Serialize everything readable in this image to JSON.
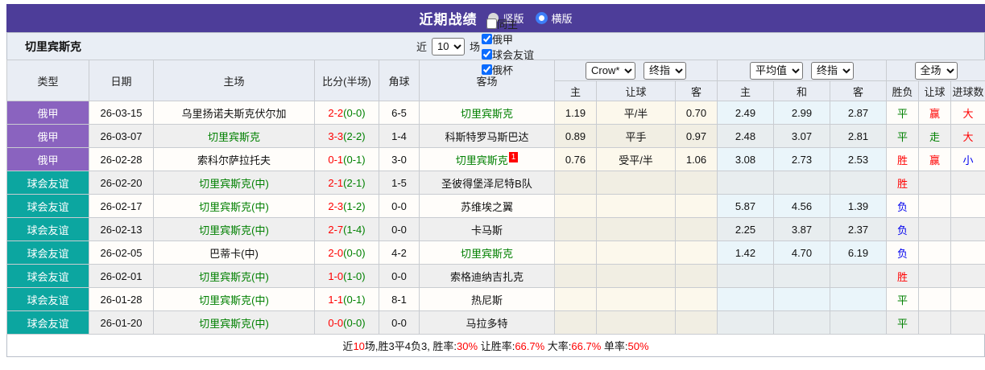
{
  "title_bar": {
    "title": "近期战绩",
    "radio_vertical": "竖版",
    "radio_horizontal": "横版",
    "selected": "横版"
  },
  "team_bar": {
    "team_name": "切里宾斯克",
    "near_label": "近",
    "matches_count": "10",
    "matches_label": "场",
    "filters": [
      {
        "label": "同主",
        "checked": false,
        "spaced": true
      },
      {
        "label": "俄甲",
        "checked": true,
        "spaced": false
      },
      {
        "label": "球会友谊",
        "checked": true,
        "spaced": false
      },
      {
        "label": "俄杯",
        "checked": true,
        "spaced": false
      }
    ]
  },
  "table": {
    "dropdowns": {
      "bookmaker": "Crow*",
      "bookmaker_stage": "终指",
      "average": "平均值",
      "average_stage": "终指",
      "scope": "全场"
    },
    "headers": {
      "type": "类型",
      "date": "日期",
      "home": "主场",
      "score": "比分(半场)",
      "corner": "角球",
      "away": "客场",
      "odds_home": "主",
      "odds_handicap": "让球",
      "odds_away": "客",
      "avg_home": "主",
      "avg_draw": "和",
      "avg_away": "客",
      "result": "胜负",
      "handicap_result": "让球",
      "goals_result": "进球数"
    },
    "rows": [
      {
        "type": "俄甲",
        "type_key": "league",
        "date": "26-03-15",
        "home": "乌里扬诺夫斯克伏尔加",
        "home_focus": false,
        "score_full": "2-2",
        "score_half": "(0-0)",
        "corner": "6-5",
        "away": "切里宾斯克",
        "away_focus": true,
        "away_badge": "",
        "crow": [
          "1.19",
          "平/半",
          "0.70"
        ],
        "avg": [
          "2.49",
          "2.99",
          "2.87"
        ],
        "result": {
          "text": "平",
          "color": "green"
        },
        "handicap": {
          "text": "赢",
          "color": "red"
        },
        "goals": {
          "text": "大",
          "color": "red"
        }
      },
      {
        "type": "俄甲",
        "type_key": "league",
        "date": "26-03-07",
        "home": "切里宾斯克",
        "home_focus": true,
        "score_full": "3-3",
        "score_half": "(2-2)",
        "corner": "1-4",
        "away": "科斯特罗马斯巴达",
        "away_focus": false,
        "away_badge": "",
        "crow": [
          "0.89",
          "平手",
          "0.97"
        ],
        "avg": [
          "2.48",
          "3.07",
          "2.81"
        ],
        "result": {
          "text": "平",
          "color": "green"
        },
        "handicap": {
          "text": "走",
          "color": "green"
        },
        "goals": {
          "text": "大",
          "color": "red"
        }
      },
      {
        "type": "俄甲",
        "type_key": "league",
        "date": "26-02-28",
        "home": "索科尔萨拉托夫",
        "home_focus": false,
        "score_full": "0-1",
        "score_half": "(0-1)",
        "corner": "3-0",
        "away": "切里宾斯克",
        "away_focus": true,
        "away_badge": "1",
        "crow": [
          "0.76",
          "受平/半",
          "1.06"
        ],
        "avg": [
          "3.08",
          "2.73",
          "2.53"
        ],
        "result": {
          "text": "胜",
          "color": "red"
        },
        "handicap": {
          "text": "赢",
          "color": "red"
        },
        "goals": {
          "text": "小",
          "color": "blue"
        }
      },
      {
        "type": "球会友谊",
        "type_key": "friendly",
        "date": "26-02-20",
        "home": "切里宾斯克(中)",
        "home_focus": true,
        "score_full": "2-1",
        "score_half": "(2-1)",
        "corner": "1-5",
        "away": "圣彼得堡泽尼特B队",
        "away_focus": false,
        "away_badge": "",
        "crow": [
          "",
          "",
          ""
        ],
        "avg": [
          "",
          "",
          ""
        ],
        "result": {
          "text": "胜",
          "color": "red"
        },
        "handicap": {
          "text": "",
          "color": ""
        },
        "goals": {
          "text": "",
          "color": ""
        }
      },
      {
        "type": "球会友谊",
        "type_key": "friendly",
        "date": "26-02-17",
        "home": "切里宾斯克(中)",
        "home_focus": true,
        "score_full": "2-3",
        "score_half": "(1-2)",
        "corner": "0-0",
        "away": "苏维埃之翼",
        "away_focus": false,
        "away_badge": "",
        "crow": [
          "",
          "",
          ""
        ],
        "avg": [
          "5.87",
          "4.56",
          "1.39"
        ],
        "result": {
          "text": "负",
          "color": "blue"
        },
        "handicap": {
          "text": "",
          "color": ""
        },
        "goals": {
          "text": "",
          "color": ""
        }
      },
      {
        "type": "球会友谊",
        "type_key": "friendly",
        "date": "26-02-13",
        "home": "切里宾斯克(中)",
        "home_focus": true,
        "score_full": "2-7",
        "score_half": "(1-4)",
        "corner": "0-0",
        "away": "卡马斯",
        "away_focus": false,
        "away_badge": "",
        "crow": [
          "",
          "",
          ""
        ],
        "avg": [
          "2.25",
          "3.87",
          "2.37"
        ],
        "result": {
          "text": "负",
          "color": "blue"
        },
        "handicap": {
          "text": "",
          "color": ""
        },
        "goals": {
          "text": "",
          "color": ""
        }
      },
      {
        "type": "球会友谊",
        "type_key": "friendly",
        "date": "26-02-05",
        "home": "巴蒂卡(中)",
        "home_focus": false,
        "score_full": "2-0",
        "score_half": "(0-0)",
        "corner": "4-2",
        "away": "切里宾斯克",
        "away_focus": true,
        "away_badge": "",
        "crow": [
          "",
          "",
          ""
        ],
        "avg": [
          "1.42",
          "4.70",
          "6.19"
        ],
        "result": {
          "text": "负",
          "color": "blue"
        },
        "handicap": {
          "text": "",
          "color": ""
        },
        "goals": {
          "text": "",
          "color": ""
        }
      },
      {
        "type": "球会友谊",
        "type_key": "friendly",
        "date": "26-02-01",
        "home": "切里宾斯克(中)",
        "home_focus": true,
        "score_full": "1-0",
        "score_half": "(1-0)",
        "corner": "0-0",
        "away": "索格迪纳吉扎克",
        "away_focus": false,
        "away_badge": "",
        "crow": [
          "",
          "",
          ""
        ],
        "avg": [
          "",
          "",
          ""
        ],
        "result": {
          "text": "胜",
          "color": "red"
        },
        "handicap": {
          "text": "",
          "color": ""
        },
        "goals": {
          "text": "",
          "color": ""
        }
      },
      {
        "type": "球会友谊",
        "type_key": "friendly",
        "date": "26-01-28",
        "home": "切里宾斯克(中)",
        "home_focus": true,
        "score_full": "1-1",
        "score_half": "(0-1)",
        "corner": "8-1",
        "away": "热尼斯",
        "away_focus": false,
        "away_badge": "",
        "crow": [
          "",
          "",
          ""
        ],
        "avg": [
          "",
          "",
          ""
        ],
        "result": {
          "text": "平",
          "color": "green"
        },
        "handicap": {
          "text": "",
          "color": ""
        },
        "goals": {
          "text": "",
          "color": ""
        }
      },
      {
        "type": "球会友谊",
        "type_key": "friendly",
        "date": "26-01-20",
        "home": "切里宾斯克(中)",
        "home_focus": true,
        "score_full": "0-0",
        "score_half": "(0-0)",
        "corner": "0-0",
        "away": "马拉多特",
        "away_focus": false,
        "away_badge": "",
        "crow": [
          "",
          "",
          ""
        ],
        "avg": [
          "",
          "",
          ""
        ],
        "result": {
          "text": "平",
          "color": "green"
        },
        "handicap": {
          "text": "",
          "color": ""
        },
        "goals": {
          "text": "",
          "color": ""
        }
      }
    ]
  },
  "summary": {
    "segments": [
      {
        "text": "近",
        "color": "black"
      },
      {
        "text": "10",
        "color": "red"
      },
      {
        "text": "场,胜3平4负3, 胜率:",
        "color": "black"
      },
      {
        "text": "30%",
        "color": "red"
      },
      {
        "text": " 让胜率:",
        "color": "black"
      },
      {
        "text": "66.7%",
        "color": "red"
      },
      {
        "text": " 大率:",
        "color": "black"
      },
      {
        "text": "66.7%",
        "color": "red"
      },
      {
        "text": " 单率:",
        "color": "black"
      },
      {
        "text": "50%",
        "color": "red"
      }
    ]
  },
  "colors": {
    "header_purple": "#4d3d99",
    "league_badge": "#8a63bf",
    "friendly_badge": "#0ca6a0",
    "focus_team_green": "#008000",
    "score_red": "#ff0000",
    "half_green": "#008000",
    "win_red": "#ff0000",
    "draw_green": "#008000",
    "lose_blue": "#0000ee",
    "crow_col_bg": "#fcf8ec",
    "avg_col_bg": "#eaf5fa",
    "row_alt_gray": "#efefef"
  }
}
